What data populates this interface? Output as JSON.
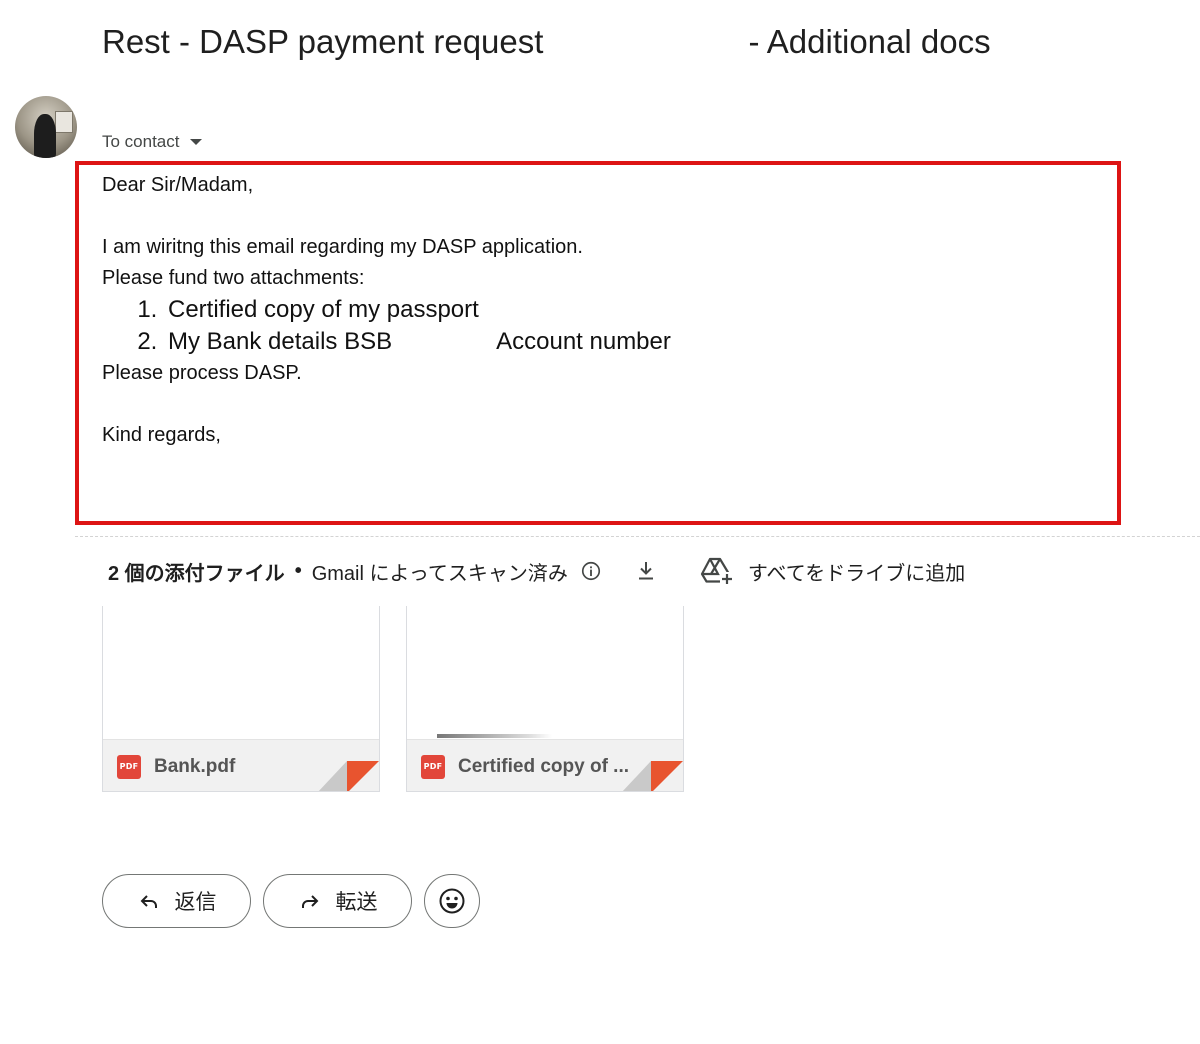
{
  "email": {
    "subject_part1": "Rest - DASP payment request",
    "subject_part2": "- Additional docs",
    "to_label": "To contact",
    "body": {
      "greeting": "Dear Sir/Madam,",
      "line1": "I am wiritng this email regarding my DASP application.",
      "line2": "Please fund two attachments:",
      "list": [
        "Certified copy of my passport",
        "My Bank details BSB"
      ],
      "list_item2_suffix": "Account number",
      "line3": "Please process DASP.",
      "closing": "Kind regards,"
    }
  },
  "attachments": {
    "count_label": "2 個の添付ファイル",
    "separator": "•",
    "scanned_label": "Gmail によってスキャン済み",
    "drive_label": "すべてをドライブに追加",
    "files": [
      {
        "name": "Bank.pdf",
        "type_badge": "PDF"
      },
      {
        "name": "Certified copy of ...",
        "type_badge": "PDF"
      }
    ]
  },
  "actions": {
    "reply_label": "返信",
    "forward_label": "転送"
  },
  "colors": {
    "highlight_border": "#dd1414",
    "pdf_red": "#e2463a",
    "fold_orange": "#e8542f"
  },
  "icons": [
    "dropdown-caret-icon",
    "info-icon",
    "download-icon",
    "drive-add-icon",
    "pdf-icon",
    "reply-icon",
    "forward-icon",
    "emoji-icon"
  ]
}
